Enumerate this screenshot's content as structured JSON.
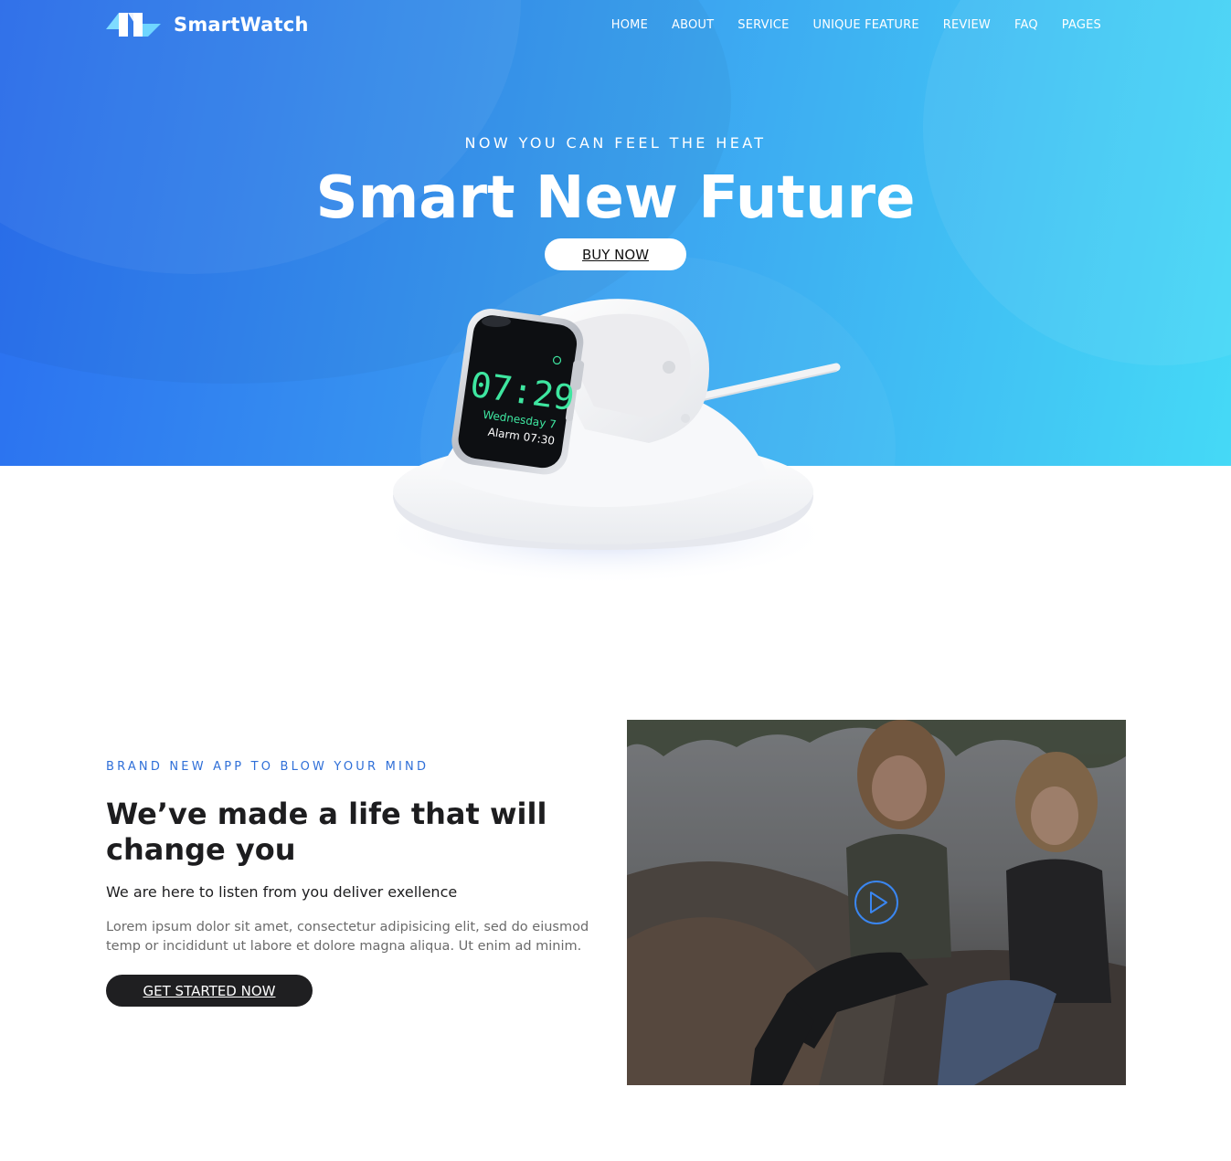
{
  "brand": {
    "name": "SmartWatch"
  },
  "nav": {
    "items": [
      "HOME",
      "ABOUT",
      "SERVICE",
      "UNIQUE FEATURE",
      "REVIEW",
      "FAQ",
      "PAGES"
    ]
  },
  "hero": {
    "eyebrow": "NOW YOU CAN FEEL THE HEAT",
    "title": "Smart New Future",
    "button_label": "BUY NOW",
    "watch": {
      "time": "07:29",
      "day": "Wednesday 7",
      "alarm": "Alarm 07:30"
    }
  },
  "about": {
    "eyebrow": "BRAND NEW APP TO BLOW YOUR MIND",
    "title": "We’ve made a life that will change you",
    "subtitle": "We are here to listen from you deliver exellence",
    "body": "Lorem ipsum dolor sit amet, consectetur adipisicing elit, sed do eiusmod temp or incididunt ut labore et dolore magna aliqua. Ut enim ad minim.",
    "button_label": "GET STARTED NOW"
  },
  "icons": {
    "logo": "logo-icon",
    "play": "play-icon"
  },
  "colors": {
    "hero_start": "#2a6ef0",
    "hero_end": "#45d9f6",
    "accent": "#2f6fd8",
    "dark_button": "#1f1f21",
    "watch_digits": "#3ee6a0"
  }
}
